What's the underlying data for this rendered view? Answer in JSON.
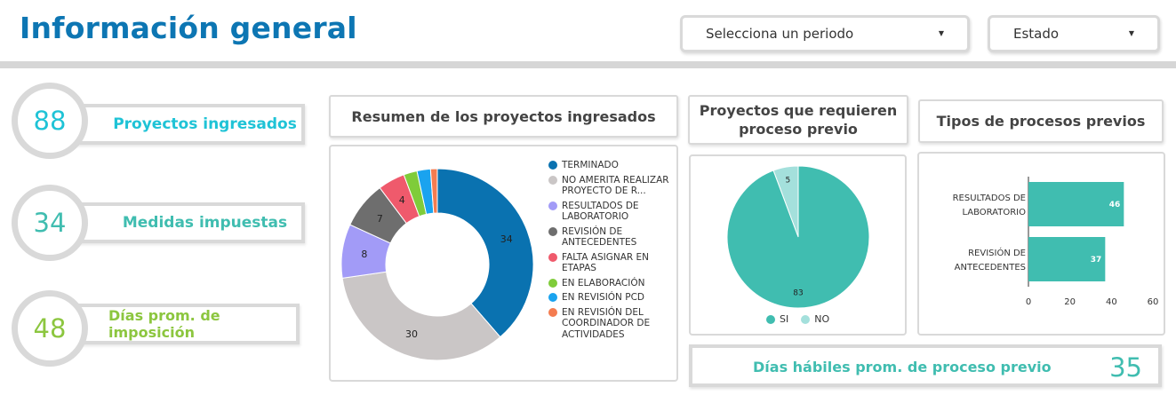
{
  "header": {
    "title": "Información general",
    "period_dropdown": "Selecciona un periodo",
    "state_dropdown": "Estado"
  },
  "kpis": [
    {
      "value": "88",
      "label": "Proyectos ingresados",
      "color": "#1fc3d6"
    },
    {
      "value": "34",
      "label": "Medidas impuestas",
      "color": "#40bdb0"
    },
    {
      "value": "48",
      "label": "Días prom. de imposición",
      "color": "#8cc63f"
    }
  ],
  "panels": {
    "summary_title": "Resumen de los proyectos ingresados",
    "previous_title": "Proyectos que requieren proceso previo",
    "types_title": "Tipos de procesos previos"
  },
  "bottom_kpi": {
    "label": "Días hábiles prom. de proceso previo",
    "value": "35"
  },
  "chart_data": [
    {
      "type": "pie",
      "variant": "donut",
      "title": "Resumen de los proyectos ingresados",
      "legend_position": "right",
      "slices": [
        {
          "label": "TERMINADO",
          "value": 34,
          "color": "#0a72b0"
        },
        {
          "label": "NO AMERITA REALIZAR PROYECTO DE R...",
          "value": 30,
          "color": "#cac6c6"
        },
        {
          "label": "RESULTADOS DE LABORATORIO",
          "value": 8,
          "color": "#a29bf7"
        },
        {
          "label": "REVISIÓN DE ANTECEDENTES",
          "value": 7,
          "color": "#6e6e6e"
        },
        {
          "label": "FALTA ASIGNAR EN ETAPAS",
          "value": 4,
          "color": "#ef5a6c"
        },
        {
          "label": "EN ELABORACIÓN",
          "value": 2,
          "color": "#7fcc3a"
        },
        {
          "label": "EN REVISIÓN PCD",
          "value": 2,
          "color": "#1aa3ef"
        },
        {
          "label": "EN REVISIÓN DEL COORDINADOR DE ACTIVIDADES",
          "value": 1,
          "color": "#f47c50"
        }
      ]
    },
    {
      "type": "pie",
      "title": "Proyectos que requieren proceso previo",
      "legend_position": "bottom",
      "slices": [
        {
          "label": "SI",
          "value": 83,
          "color": "#40bdb0"
        },
        {
          "label": "NO",
          "value": 5,
          "color": "#a4e0dc"
        }
      ]
    },
    {
      "type": "bar",
      "orientation": "horizontal",
      "title": "Tipos de procesos previos",
      "categories": [
        "RESULTADOS DE LABORATORIO",
        "REVISIÓN DE ANTECEDENTES"
      ],
      "category_lines": [
        [
          "RESULTADOS DE",
          "LABORATORIO"
        ],
        [
          "REVISIÓN DE",
          "ANTECEDENTES"
        ]
      ],
      "values": [
        46,
        37
      ],
      "xlim": [
        0,
        60
      ],
      "xticks": [
        "0",
        "20",
        "40",
        "60"
      ],
      "color": "#40bdb0",
      "grid": false
    }
  ]
}
